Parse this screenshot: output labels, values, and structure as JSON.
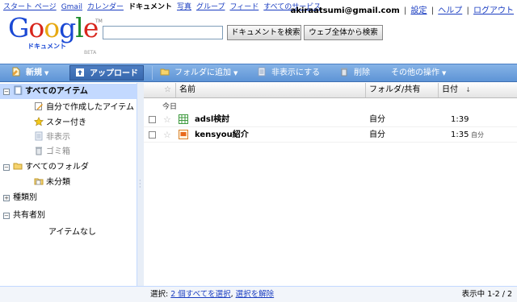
{
  "topnav": {
    "links": [
      "スタート ページ",
      "Gmail",
      "カレンダー",
      "ドキュメント",
      "写真",
      "グループ",
      "フィード",
      "すべてのサービス"
    ],
    "current": "ドキュメント",
    "email": "akiraatsumi@gmail.com",
    "account_links": [
      "設定",
      "ヘルプ",
      "ログアウト"
    ]
  },
  "logo": {
    "text": "Google",
    "sub": "ドキュメント",
    "beta": "BETA",
    "tm": "TM"
  },
  "search": {
    "value": "",
    "placeholder": "",
    "btn_docs": "ドキュメントを検索",
    "btn_web": "ウェブ全体から検索"
  },
  "toolbar": {
    "new": "新規",
    "upload": "アップロード",
    "folder": "フォルダに追加",
    "hide": "非表示にする",
    "delete": "削除",
    "more": "その他の操作"
  },
  "sidebar": {
    "all_items": "すべてのアイテム",
    "my_items": "自分で作成したアイテム",
    "starred": "スター付き",
    "hidden": "非表示",
    "trash": "ゴミ箱",
    "all_folders": "すべてのフォルダ",
    "unfiled": "未分類",
    "types": "種類別",
    "shared_with": "共有者別",
    "no_items": "アイテムなし"
  },
  "columns": {
    "star": "☆",
    "name": "名前",
    "folder": "フォルダ/共有",
    "date": "日付",
    "sort": "↓"
  },
  "group_today": "今日",
  "docs": [
    {
      "name": "adsl検討",
      "owner": "自分",
      "date": "1:39",
      "by": "",
      "type": "spreadsheet"
    },
    {
      "name": "kensyou紹介",
      "owner": "自分",
      "date": "1:35",
      "by": "自分",
      "type": "presentation"
    }
  ],
  "status": {
    "label": "選択:",
    "select_all_prefix": "2 個すべてを選択",
    "select_none": "選択を解除",
    "count": "表示中 1-2 / 2"
  },
  "colors": {
    "toolbar": "#5d94d6",
    "selection": "#c3d9ff",
    "link": "#1a3dc1"
  }
}
